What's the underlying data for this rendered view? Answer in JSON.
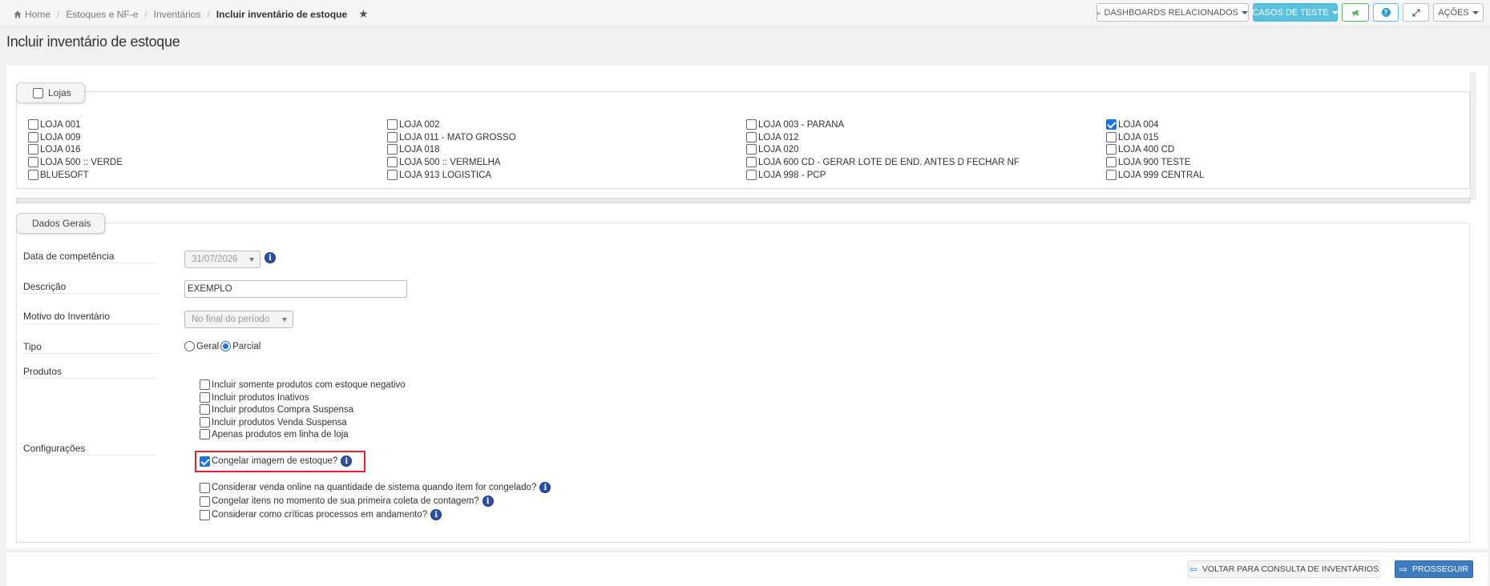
{
  "breadcrumb": {
    "home": "Home",
    "items": [
      "Estoques e NF-e",
      "Inventários"
    ],
    "current": "Incluir inventário de estoque",
    "star_icon": "star-icon"
  },
  "toolbar": {
    "dashboards": "DASHBOARDS RELACIONADOS",
    "test_cases": "CASOS DE TESTE",
    "actions": "AÇÕES"
  },
  "page": {
    "title": "Incluir inventário de estoque"
  },
  "stores": {
    "legend": "Lojas",
    "items": [
      {
        "label": "LOJA 001",
        "checked": false
      },
      {
        "label": "LOJA 002",
        "checked": false
      },
      {
        "label": "LOJA 003 - PARANA",
        "checked": false
      },
      {
        "label": "LOJA 004",
        "checked": true
      },
      {
        "label": "LOJA 009",
        "checked": false
      },
      {
        "label": "LOJA 011 - MATO GROSSO",
        "checked": false
      },
      {
        "label": "LOJA 012",
        "checked": false
      },
      {
        "label": "LOJA 015",
        "checked": false
      },
      {
        "label": "LOJA 016",
        "checked": false
      },
      {
        "label": "LOJA 018",
        "checked": false
      },
      {
        "label": "LOJA 020",
        "checked": false
      },
      {
        "label": "LOJA 400 CD",
        "checked": false
      },
      {
        "label": "LOJA 500 :: VERDE",
        "checked": false
      },
      {
        "label": "LOJA 500 :: VERMELHA",
        "checked": false
      },
      {
        "label": "LOJA 600 CD - GERAR LOTE DE END. ANTES D FECHAR NF",
        "checked": false
      },
      {
        "label": "LOJA 900 TESTE",
        "checked": false
      },
      {
        "label": "BLUESOFT",
        "checked": false
      },
      {
        "label": "LOJA 913 LOGISTICA",
        "checked": false
      },
      {
        "label": "LOJA 998 - PCP",
        "checked": false
      },
      {
        "label": "LOJA 999 CENTRAL",
        "checked": false
      }
    ]
  },
  "general": {
    "legend": "Dados Gerais",
    "competence_label": "Data de competência",
    "competence_value": "31/07/2026",
    "description_label": "Descrição",
    "description_value": "EXEMPLO",
    "reason_label": "Motivo do Inventário",
    "reason_value": "No final do período",
    "type_label": "Tipo",
    "type_options": [
      {
        "label": "Geral",
        "checked": false
      },
      {
        "label": "Parcial",
        "checked": true
      }
    ],
    "products_label": "Produtos",
    "product_options": [
      {
        "label": "Incluir somente produtos com estoque negativo",
        "checked": false
      },
      {
        "label": "Incluir produtos Inativos",
        "checked": false
      },
      {
        "label": "Incluir produtos Compra Suspensa",
        "checked": false
      },
      {
        "label": "Incluir produtos Venda Suspensa",
        "checked": false
      },
      {
        "label": "Apenas produtos em linha de loja",
        "checked": false
      }
    ],
    "config_label": "Configurações",
    "config_options": [
      {
        "label": "Congelar imagem de estoque?",
        "checked": true,
        "info": true
      },
      {
        "label": "Considerar venda online na quantidade de sistema quando item for congelado?",
        "checked": false,
        "info": true
      },
      {
        "label": "Congelar itens no momento de sua primeira coleta de contagem?",
        "checked": false,
        "info": true
      },
      {
        "label": "Considerar como críticas processos em andamento?",
        "checked": false,
        "info": true
      }
    ]
  },
  "footer": {
    "back": "VOLTAR PARA CONSULTA DE INVENTÁRIOS",
    "next": "PROSSEGUIR"
  },
  "colors": {
    "accent": "#1a73e8",
    "info_button": "#5bc0de",
    "primary_button": "#3e7bbf",
    "highlight": "#e0242b"
  }
}
